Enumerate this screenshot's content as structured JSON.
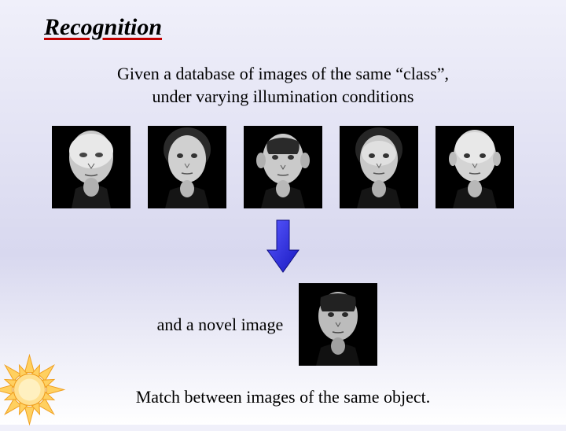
{
  "title": "Recognition",
  "subtitle_line1": "Given a database of images of the same  “class”,",
  "subtitle_line2": "under varying illumination conditions",
  "novel_label": "and a novel image",
  "bottom_text": "Match between images of the same object.",
  "face_count": 5,
  "icons": {
    "arrow": "down-arrow-icon",
    "sun": "sun-icon"
  },
  "colors": {
    "arrow_fill": "#3030f0",
    "sun_fill": "#ffd060",
    "sun_stroke": "#f0a020",
    "underline": "#c00000"
  }
}
